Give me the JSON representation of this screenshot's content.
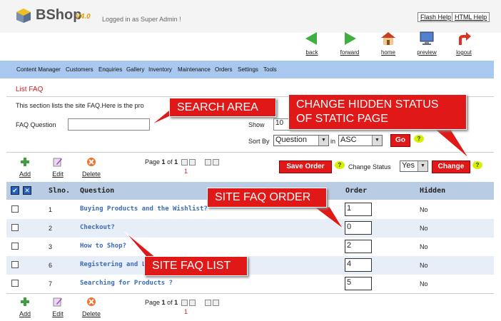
{
  "header": {
    "logo": "BShop",
    "version": "V4.0",
    "logged_in": "Logged in as Super Admin !",
    "flash_help": "Flash Help",
    "html_help": "HTML Help"
  },
  "nav": {
    "back": "back",
    "forward": "forward",
    "home": "home",
    "preview": "preview",
    "logout": "logout"
  },
  "menu": [
    "Content Manager",
    "Customers",
    "Enquiries",
    "Gallery",
    "Inventory",
    "Maintenance",
    "Orders",
    "Settings",
    "Tools"
  ],
  "page": {
    "title": "List FAQ",
    "description": "This section lists the site FAQ.Here is the pro"
  },
  "search": {
    "faq_question_label": "FAQ Question",
    "faq_question_value": "",
    "show_label": "Show",
    "show_value": "10",
    "sort_by_label": "Sort By",
    "sort_by_value": "Question",
    "in_label": "in",
    "order_value": "ASC",
    "go_label": "Go"
  },
  "toolbar": {
    "add": "Add",
    "edit": "Edit",
    "delete": "Delete",
    "page_label": "Page",
    "page_current": "1",
    "page_of": "of",
    "page_total": "1",
    "page_link": "1",
    "save_order": "Save Order",
    "change_status_label": "Change Status",
    "change_status_value": "Yes",
    "change": "Change",
    "help": "?"
  },
  "table": {
    "headers": {
      "slno": "Slno.",
      "question": "Question",
      "order": "Order",
      "hidden": "Hidden"
    },
    "rows": [
      {
        "slno": "1",
        "question": "Buying Products and the Wishlist?",
        "order": "1",
        "hidden": "No"
      },
      {
        "slno": "2",
        "question": "Checkout?",
        "order": "0",
        "hidden": "No"
      },
      {
        "slno": "3",
        "question": "How to Shop?",
        "order": "2",
        "hidden": "No"
      },
      {
        "slno": "6",
        "question": "Registering and L",
        "order": "4",
        "hidden": "No"
      },
      {
        "slno": "7",
        "question": "Searching for Products ?",
        "order": "5",
        "hidden": "No"
      }
    ]
  },
  "callouts": {
    "search_area": "SEARCH AREA",
    "change_hidden_line1": "CHANGE HIDDEN STATUS",
    "change_hidden_line2": "OF STATIC PAGE",
    "site_faq_order": "SITE FAQ ORDER",
    "site_faq_list": "SITE FAQ LIST"
  },
  "colors": {
    "accent_red": "#e01818",
    "menu_bg": "#a8c8f0",
    "table_header_bg": "#b8cce4",
    "link_blue": "#3a6ab8"
  }
}
